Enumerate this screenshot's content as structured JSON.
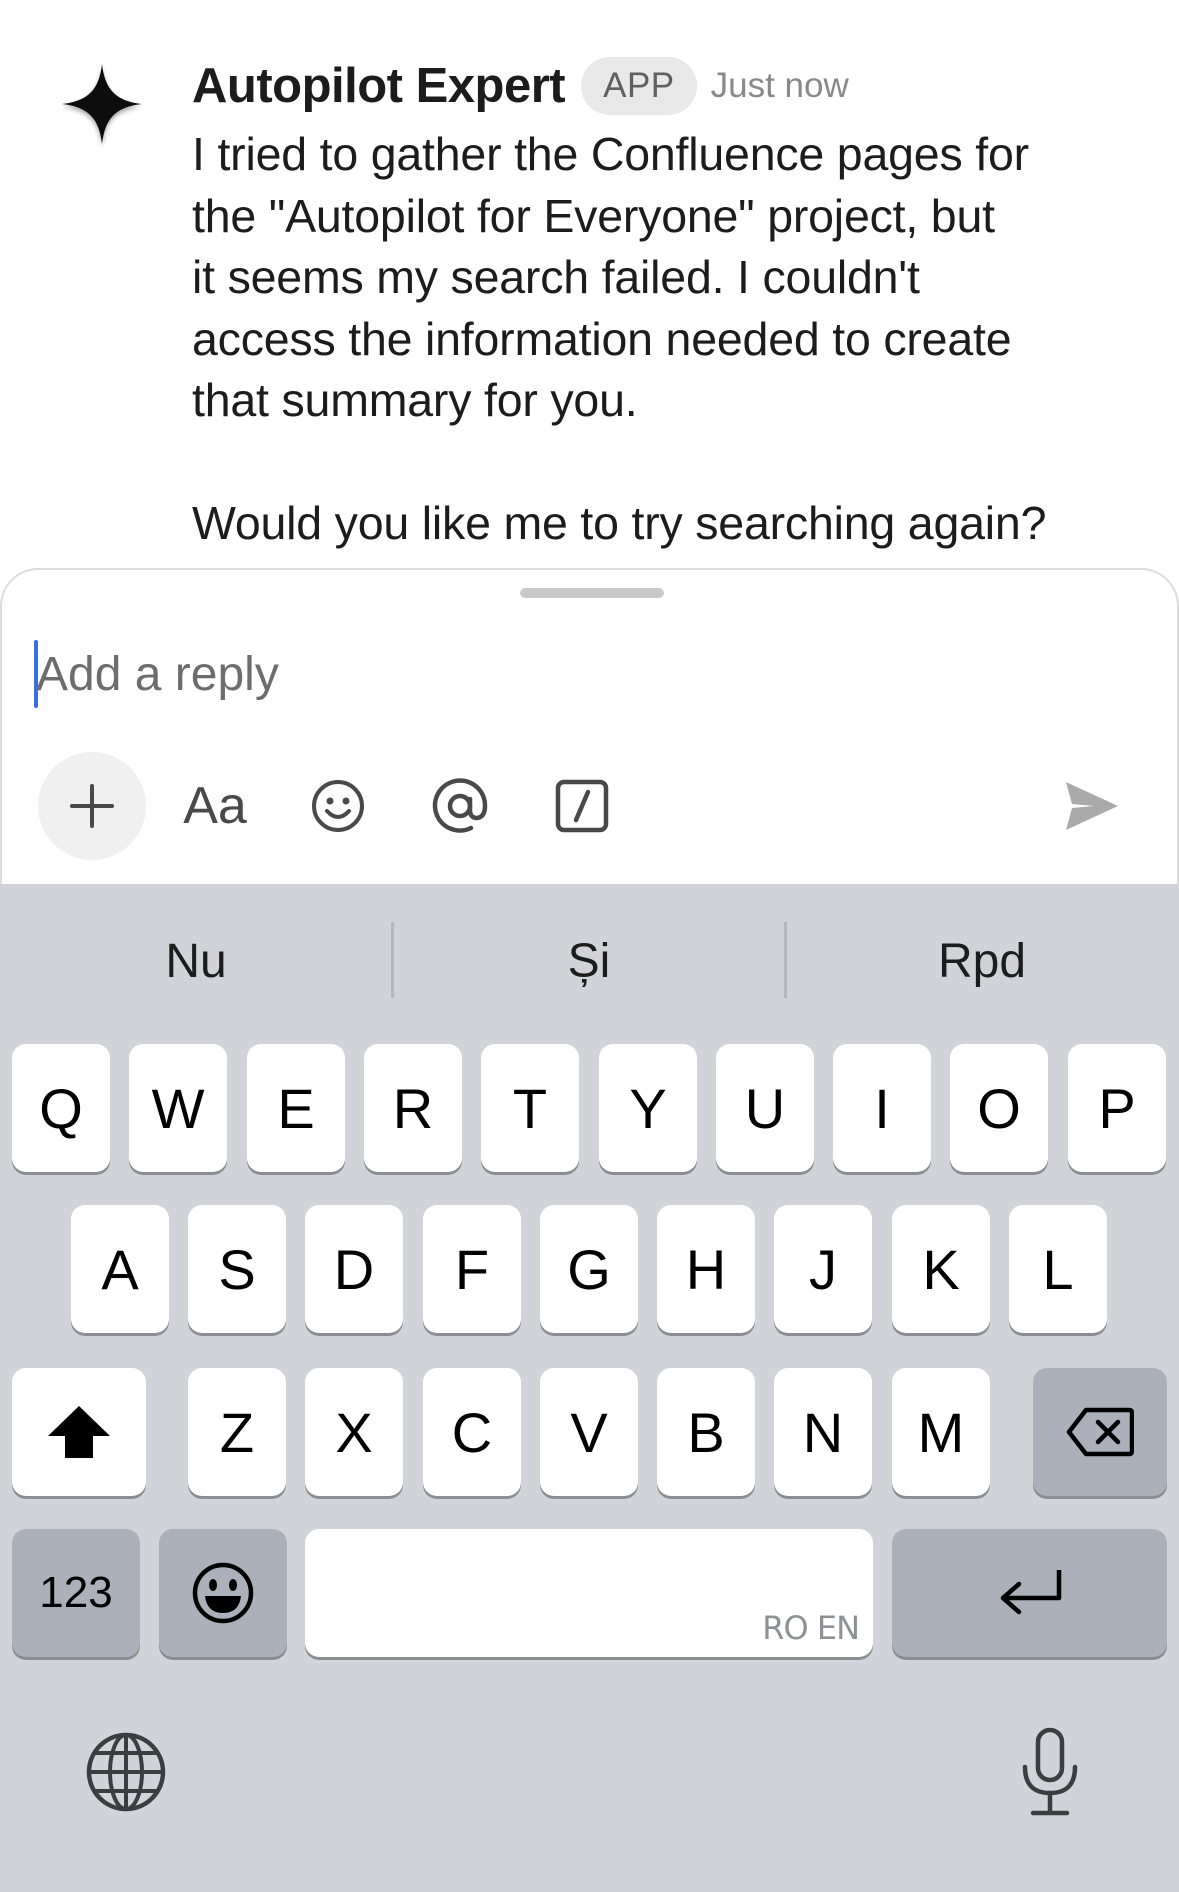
{
  "message": {
    "sender": "Autopilot Expert",
    "badge": "APP",
    "timestamp": "Just now",
    "text": "I tried to gather the Confluence pages for\nthe \"Autopilot for Everyone\" project, but\nit seems my search failed. I couldn't\naccess the information needed to create\nthat summary for you.\n\nWould you like me to try searching again?",
    "avatar_icon": "sparkle-star-icon"
  },
  "composer": {
    "placeholder": "Add a reply",
    "value": "",
    "tools": {
      "plus": "plus-icon",
      "format_label": "Aa",
      "emoji": "smiley-icon",
      "mention": "at-icon",
      "shortcut": "slash-command-icon",
      "send": "send-icon"
    },
    "accent_color": "#3b6ce8"
  },
  "keyboard": {
    "suggestions": [
      "Nu",
      "Și",
      "Rpd"
    ],
    "row1": [
      "Q",
      "W",
      "E",
      "R",
      "T",
      "Y",
      "U",
      "I",
      "O",
      "P"
    ],
    "row2": [
      "A",
      "S",
      "D",
      "F",
      "G",
      "H",
      "J",
      "K",
      "L"
    ],
    "row3": [
      "Z",
      "X",
      "C",
      "V",
      "B",
      "N",
      "M"
    ],
    "numbers_label": "123",
    "space_hint": "RO EN",
    "icons": {
      "shift": "shift-icon",
      "delete": "backspace-icon",
      "emoji": "emoji-icon",
      "return": "return-icon",
      "globe": "globe-icon",
      "mic": "microphone-icon"
    }
  }
}
